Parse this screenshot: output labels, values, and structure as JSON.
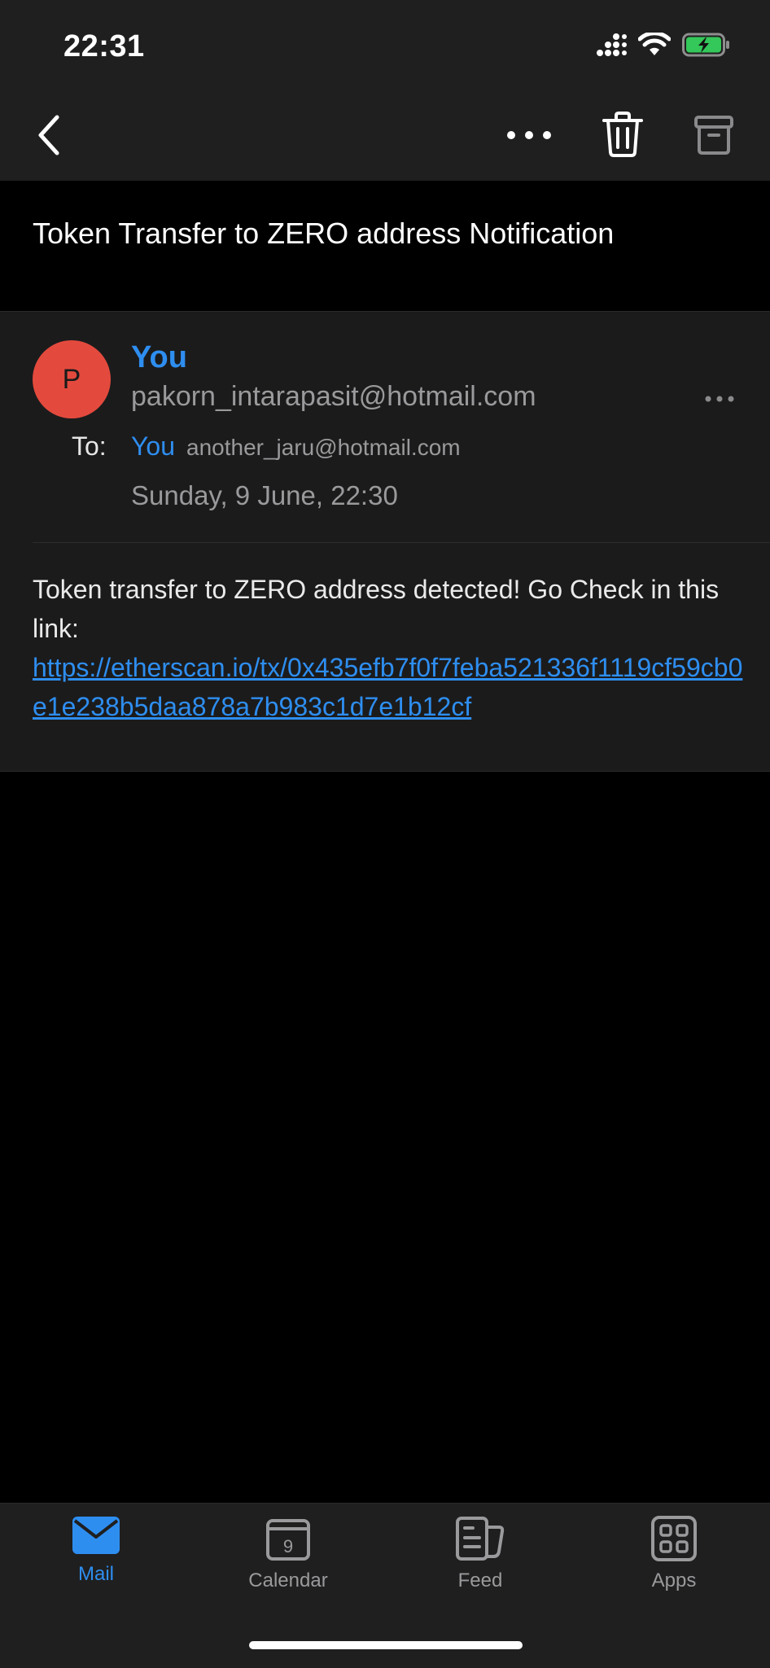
{
  "status_bar": {
    "time": "22:31"
  },
  "message": {
    "subject": "Token Transfer to ZERO address Notification",
    "avatar_initial": "P",
    "sender_name": "You",
    "sender_email": "pakorn_intarapasit@hotmail.com",
    "to_label": "To:",
    "to_name": "You",
    "to_email": "another_jaru@hotmail.com",
    "date": "Sunday, 9 June, 22:30",
    "body_text": "Token transfer to ZERO address detected! Go Check in this link:",
    "link": "https://etherscan.io/tx/0x435efb7f0f7feba521336f1119cf59cb0e1e238b5daa878a7b983c1d7e1b12cf"
  },
  "tabs": [
    {
      "label": "Mail",
      "icon": "mail-icon",
      "active": true
    },
    {
      "label": "Calendar",
      "icon": "calendar-icon",
      "active": false,
      "day": "9"
    },
    {
      "label": "Feed",
      "icon": "feed-icon",
      "active": false
    },
    {
      "label": "Apps",
      "icon": "apps-icon",
      "active": false
    }
  ],
  "colors": {
    "accent": "#2e8ef0",
    "avatar": "#e34a3d",
    "battery": "#34c759"
  }
}
